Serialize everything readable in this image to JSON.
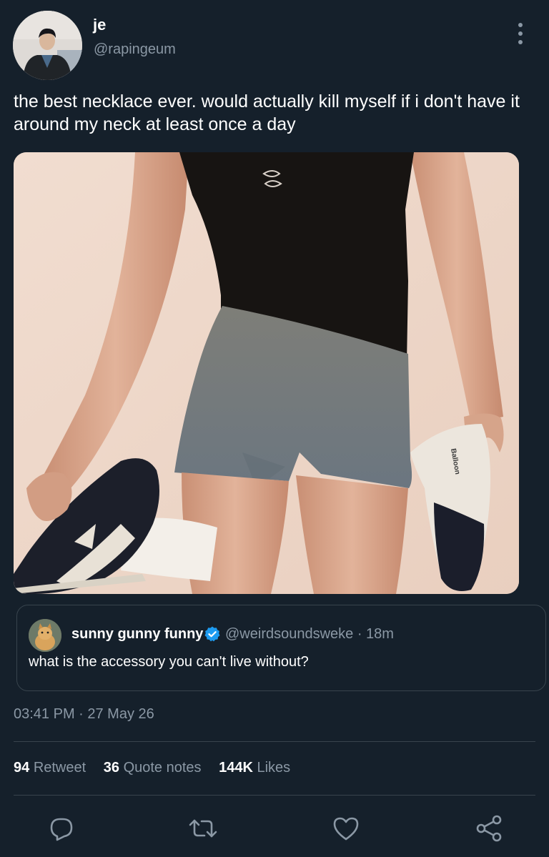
{
  "author": {
    "display_name": "je",
    "handle": "@rapingeum"
  },
  "tweet": {
    "text": "the best necklace ever. would actually kill myself if i don't have it around my neck at least once a day",
    "timestamp": "03:41 PM · 27 May 26"
  },
  "quote": {
    "display_name": "sunny gunny funny",
    "handle_time": "@weirdsoundsweke · 18m",
    "text": "what is the accessory you can't live without?"
  },
  "stats": [
    {
      "count": "94",
      "label": "Retweet"
    },
    {
      "count": "36",
      "label": "Quote notes"
    },
    {
      "count": "144K",
      "label": "Likes"
    }
  ],
  "media": {
    "cap_brand": "Balloon"
  },
  "colors": {
    "background": "#15202b",
    "secondary_text": "#8b98a5",
    "border": "#38444d",
    "verified": "#1d9bf0"
  },
  "icons": [
    "more-vertical-icon",
    "verified-icon",
    "reply-icon",
    "retweet-icon",
    "like-icon",
    "share-icon"
  ]
}
